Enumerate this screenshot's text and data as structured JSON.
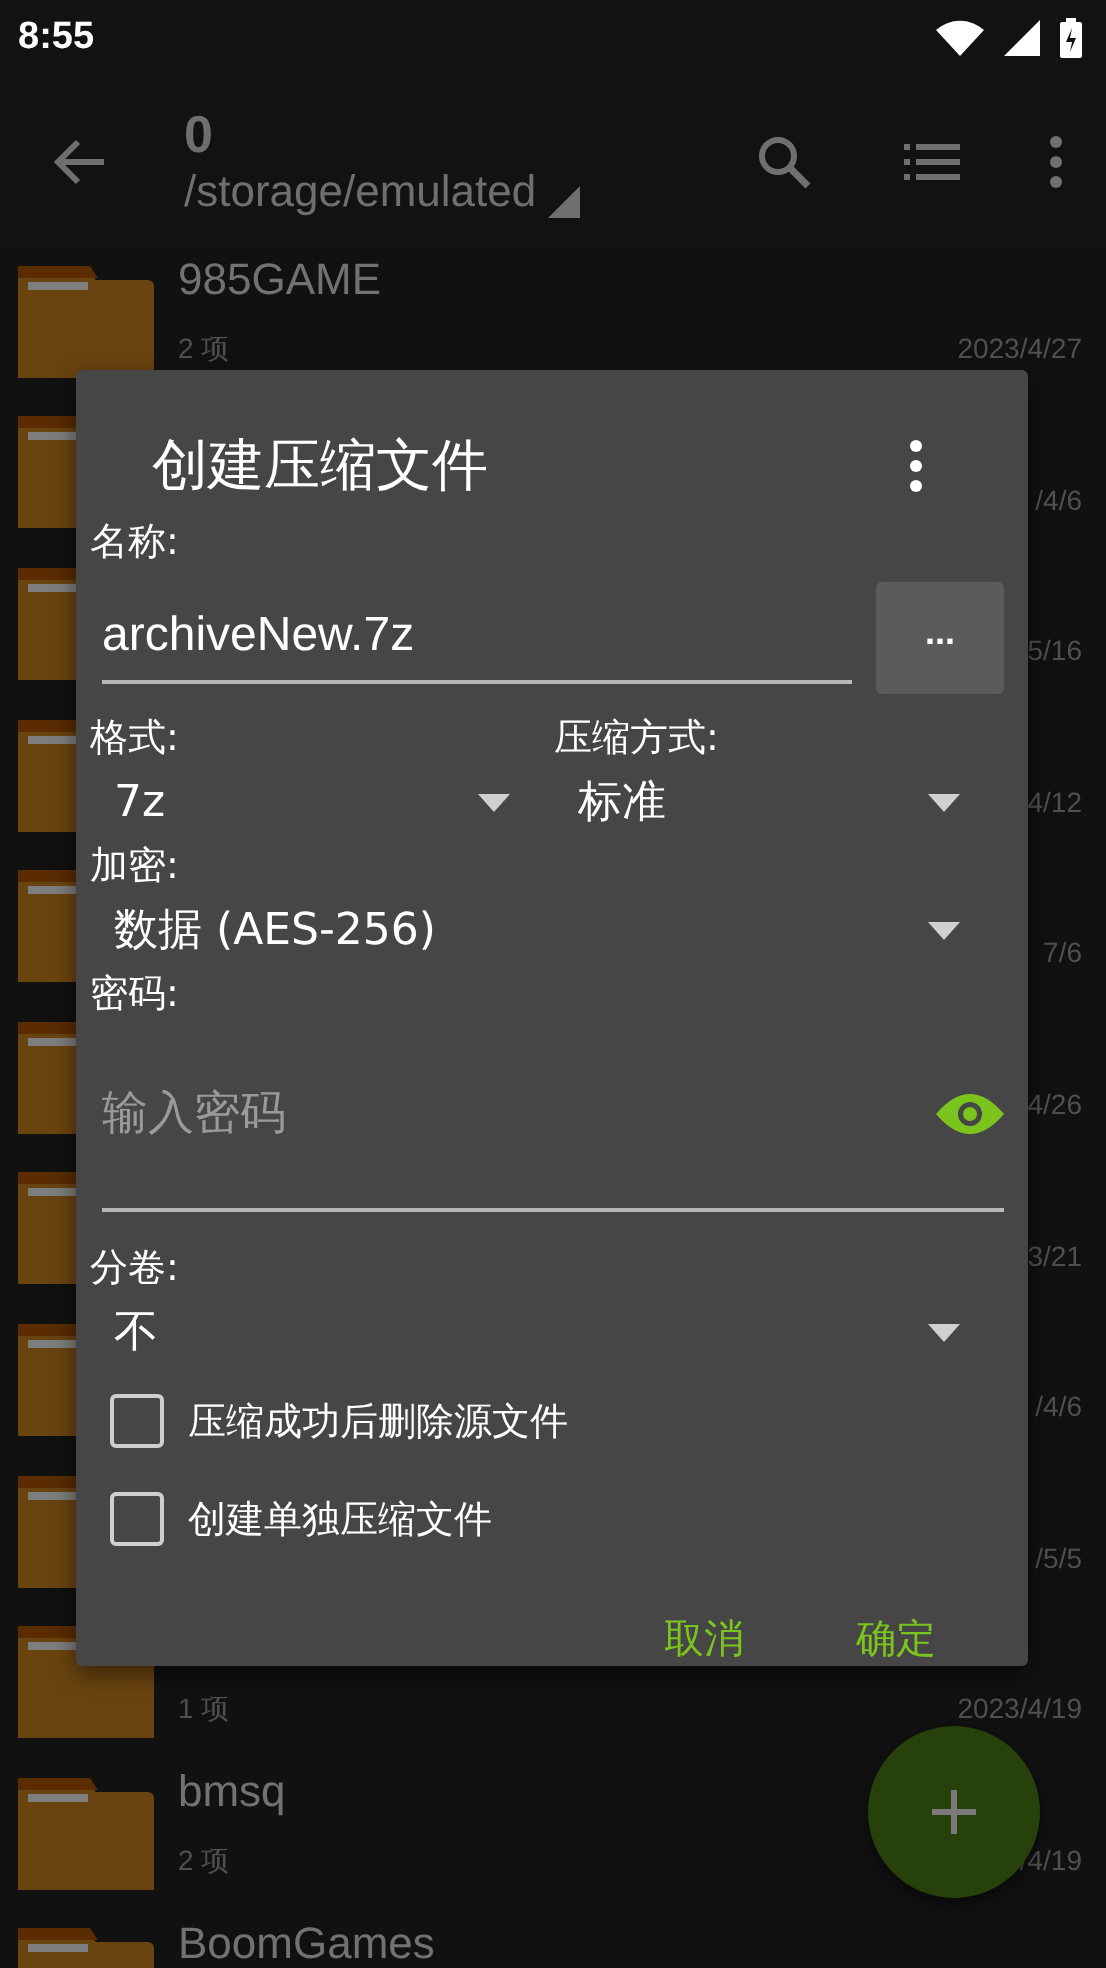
{
  "status_bar": {
    "time": "8:55"
  },
  "toolbar": {
    "title": "0",
    "path": "/storage/emulated"
  },
  "files": [
    {
      "name": "985GAME",
      "count": "2 项",
      "date": "2023/4/27"
    },
    {
      "date": "/4/6"
    },
    {
      "date": "5/16"
    },
    {
      "date": "4/12"
    },
    {
      "date": "7/6"
    },
    {
      "date": "4/26"
    },
    {
      "date": "3/21"
    },
    {
      "date": "/4/6"
    },
    {
      "date": "/5/5"
    },
    {
      "count": "1 项",
      "date": "2023/4/19"
    },
    {
      "name": "bmsq",
      "count": "2 项",
      "date": "/4/19"
    },
    {
      "name": "BoomGames"
    }
  ],
  "dialog": {
    "title": "创建压缩文件",
    "name_label": "名称:",
    "name_value": "archiveNew.7z",
    "browse_button": "...",
    "format_label": "格式:",
    "format_value": "7z",
    "method_label": "压缩方式:",
    "method_value": "标准",
    "encryption_label": "加密:",
    "encryption_value": "数据 (AES-256)",
    "password_label": "密码:",
    "password_placeholder": "输入密码",
    "split_label": "分卷:",
    "split_value": "不",
    "options": [
      {
        "label": "压缩成功后删除源文件",
        "checked": false
      },
      {
        "label": "创建单独压缩文件",
        "checked": false
      }
    ],
    "buttons": [
      "取消",
      "确定"
    ]
  }
}
